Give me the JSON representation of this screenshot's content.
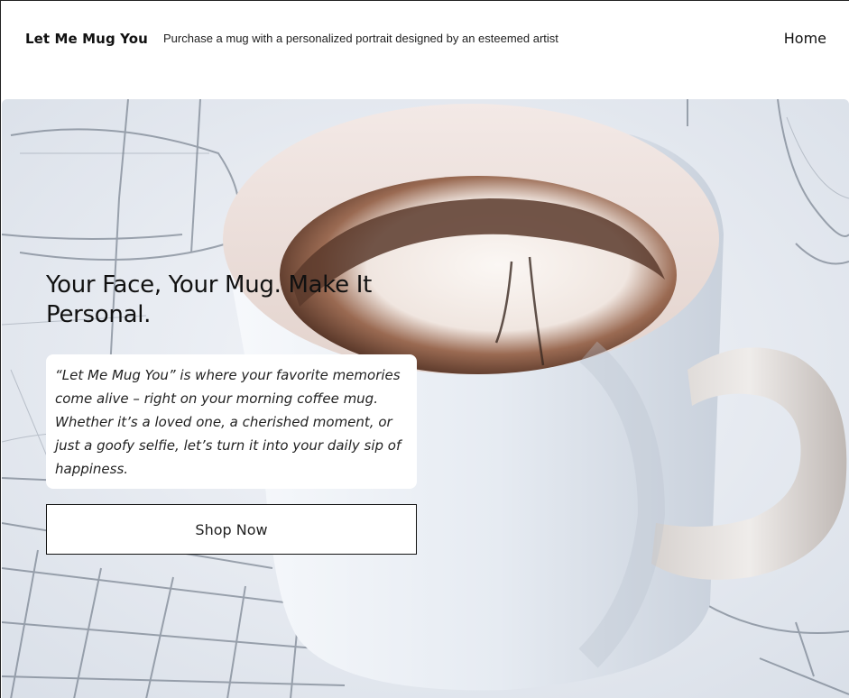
{
  "header": {
    "site_title": "Let Me Mug You",
    "tagline": "Purchase a mug with a personalized portrait designed by an esteemed artist",
    "nav": [
      {
        "label": "Home"
      }
    ]
  },
  "hero": {
    "image_description_icon": "coffee-mug-image",
    "heading": "Your Face, Your Mug. Make It Personal.",
    "quote": "“Let Me Mug You” is where your favorite memories come alive – right on your morning coffee mug. Whether it’s a loved one, a cherished moment, or just a goofy selfie, let’s turn it into your daily sip of happiness.",
    "cta_label": "Shop Now"
  },
  "colors": {
    "page_background": "#ffffff",
    "text_primary": "#111111",
    "hero_background": "#e9edf3",
    "mug_body": "#eef2f7",
    "coffee": "#5a3a2b"
  }
}
